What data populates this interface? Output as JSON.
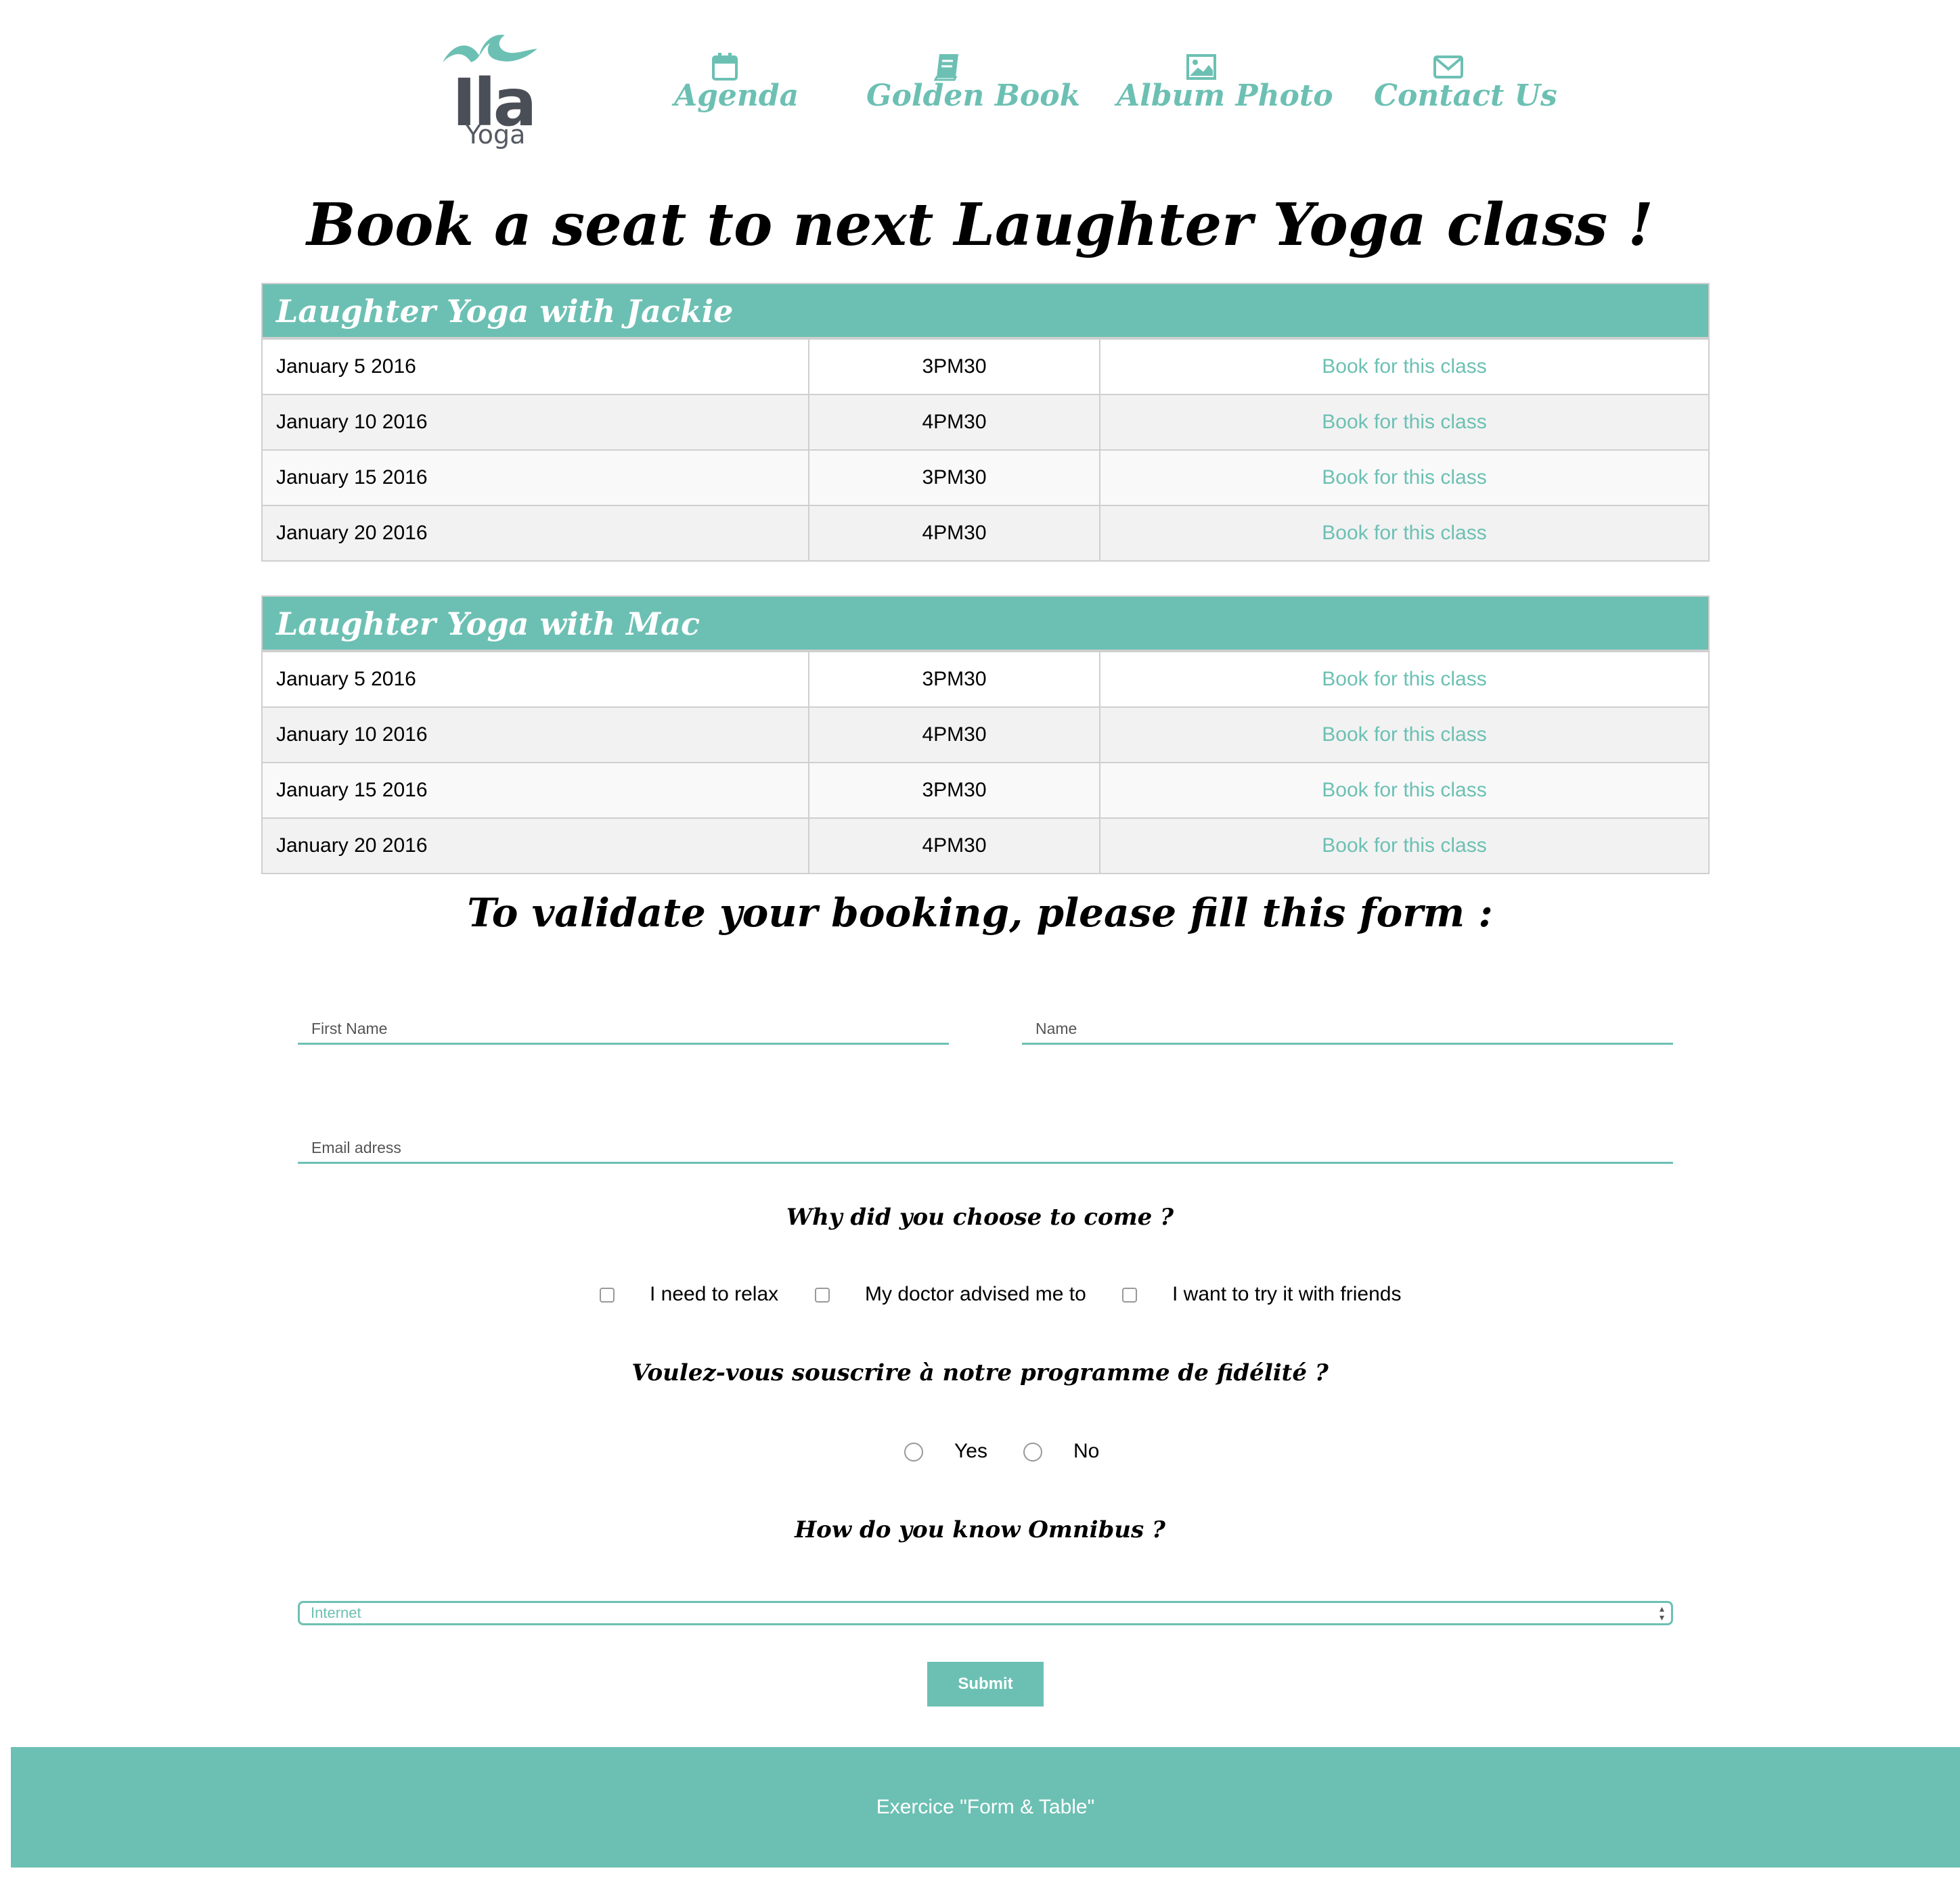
{
  "brand": {
    "name": "Ila",
    "tagline": "Yoga",
    "accent_color": "#6cc0b3"
  },
  "nav": [
    {
      "label": "Agenda",
      "icon": "calendar-icon"
    },
    {
      "label": "Golden Book",
      "icon": "book-icon"
    },
    {
      "label": "Album Photo",
      "icon": "image-icon"
    },
    {
      "label": "Contact Us",
      "icon": "envelope-icon"
    }
  ],
  "page_title": "Book a seat to next Laughter Yoga class !",
  "classes": [
    {
      "title": "Laughter Yoga with Jackie",
      "rows": [
        {
          "date": "January 5 2016",
          "time": "3PM30",
          "action": "Book for this class"
        },
        {
          "date": "January 10 2016",
          "time": "4PM30",
          "action": "Book for this class"
        },
        {
          "date": "January 15 2016",
          "time": "3PM30",
          "action": "Book for this class"
        },
        {
          "date": "January 20 2016",
          "time": "4PM30",
          "action": "Book for this class"
        }
      ]
    },
    {
      "title": "Laughter Yoga with Mac",
      "rows": [
        {
          "date": "January 5 2016",
          "time": "3PM30",
          "action": "Book for this class"
        },
        {
          "date": "January 10 2016",
          "time": "4PM30",
          "action": "Book for this class"
        },
        {
          "date": "January 15 2016",
          "time": "3PM30",
          "action": "Book for this class"
        },
        {
          "date": "January 20 2016",
          "time": "4PM30",
          "action": "Book for this class"
        }
      ]
    }
  ],
  "form": {
    "title": "To validate your booking, please fill this form :",
    "first_name_placeholder": "First Name",
    "name_placeholder": "Name",
    "email_placeholder": "Email adress",
    "reason_question": "Why did you choose to come ?",
    "reasons": [
      "I need to relax",
      "My doctor advised me to",
      "I want to try it with friends"
    ],
    "loyalty_question": "Voulez-vous souscrire à notre programme de fidélité ?",
    "loyalty_options": [
      "Yes",
      "No"
    ],
    "source_question": "How do you know Omnibus ?",
    "source_selected": "Internet",
    "submit_label": "Submit"
  },
  "footer": {
    "text": "Exercice \"Form & Table\""
  }
}
